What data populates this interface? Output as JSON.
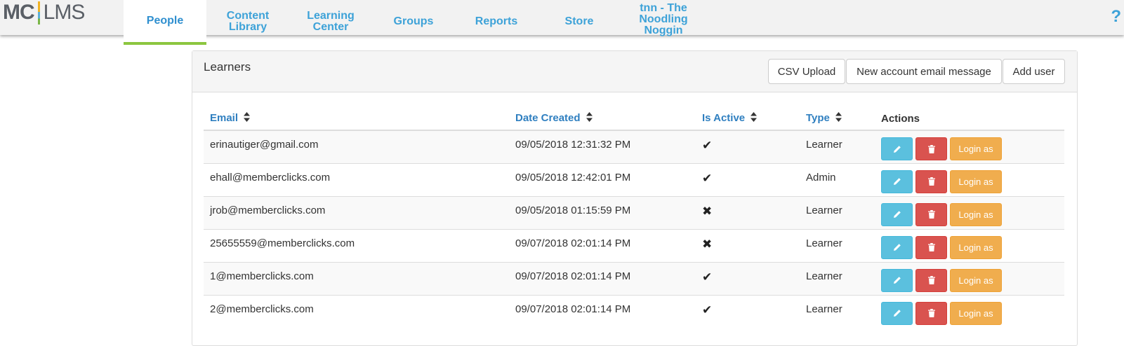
{
  "app": {
    "logo_mc": "MC",
    "logo_lms": "LMS"
  },
  "nav": {
    "tabs": [
      {
        "label": "People",
        "active": true
      },
      {
        "label": "Content Library"
      },
      {
        "label": "Learning Center"
      },
      {
        "label": "Groups"
      },
      {
        "label": "Reports"
      },
      {
        "label": "Store"
      },
      {
        "label": "tnn - The Noodling Noggin"
      }
    ],
    "help": "?"
  },
  "panel": {
    "title": "Learners",
    "buttons": {
      "csv": "CSV Upload",
      "email": "New account email message",
      "add": "Add user"
    }
  },
  "table": {
    "headers": {
      "email": "Email",
      "date": "Date Created",
      "active": "Is Active",
      "type": "Type",
      "actions": "Actions"
    },
    "login_label": "Login as",
    "rows": [
      {
        "email": "erinautiger@gmail.com",
        "date": "09/05/2018 12:31:32 PM",
        "active": "✔",
        "type": "Learner"
      },
      {
        "email": "ehall@memberclicks.com",
        "date": "09/05/2018 12:42:01 PM",
        "active": "✔",
        "type": "Admin"
      },
      {
        "email": "jrob@memberclicks.com",
        "date": "09/05/2018 01:15:59 PM",
        "active": "✖",
        "type": "Learner"
      },
      {
        "email": "25655559@memberclicks.com",
        "date": "09/07/2018 02:01:14 PM",
        "active": "✖",
        "type": "Learner"
      },
      {
        "email": "1@memberclicks.com",
        "date": "09/07/2018 02:01:14 PM",
        "active": "✔",
        "type": "Learner"
      },
      {
        "email": "2@memberclicks.com",
        "date": "09/07/2018 02:01:14 PM",
        "active": "✔",
        "type": "Learner"
      }
    ]
  },
  "colors": {
    "accent": "#3da2d8",
    "active_tab_underline": "#8cc63f",
    "edit": "#5bc0de",
    "delete": "#d9534f",
    "login": "#f0ad4e"
  }
}
